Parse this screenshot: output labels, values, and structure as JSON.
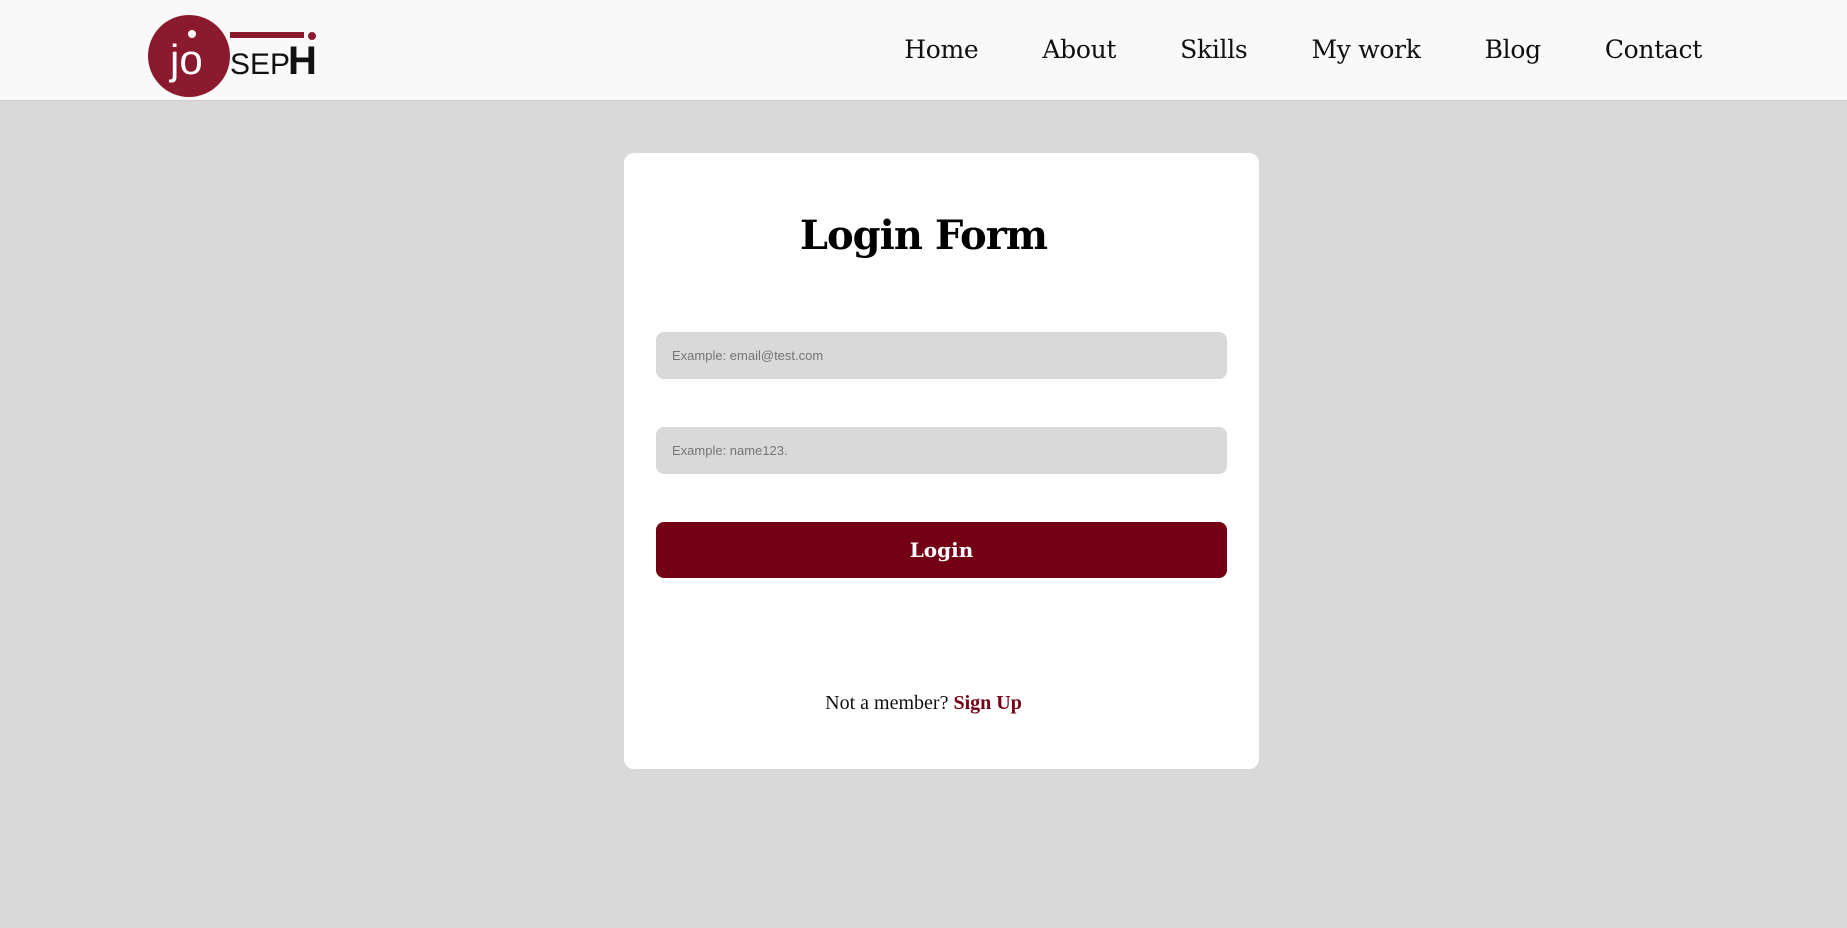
{
  "brand": {
    "logo_text_jo": "jo",
    "logo_text_sep": "SEP",
    "logo_text_h": "H",
    "accent_color": "#8b1a2e"
  },
  "nav": {
    "items": [
      {
        "label": "Home"
      },
      {
        "label": "About"
      },
      {
        "label": "Skills"
      },
      {
        "label": "My work"
      },
      {
        "label": "Blog"
      },
      {
        "label": "Contact"
      }
    ]
  },
  "login_form": {
    "title": "Login Form",
    "email_placeholder": "Example: email@test.com",
    "password_placeholder": "Example: name123.",
    "login_label": "Login",
    "signup_prompt": "Not a member?",
    "signup_label": "Sign Up",
    "button_color": "#730015"
  }
}
